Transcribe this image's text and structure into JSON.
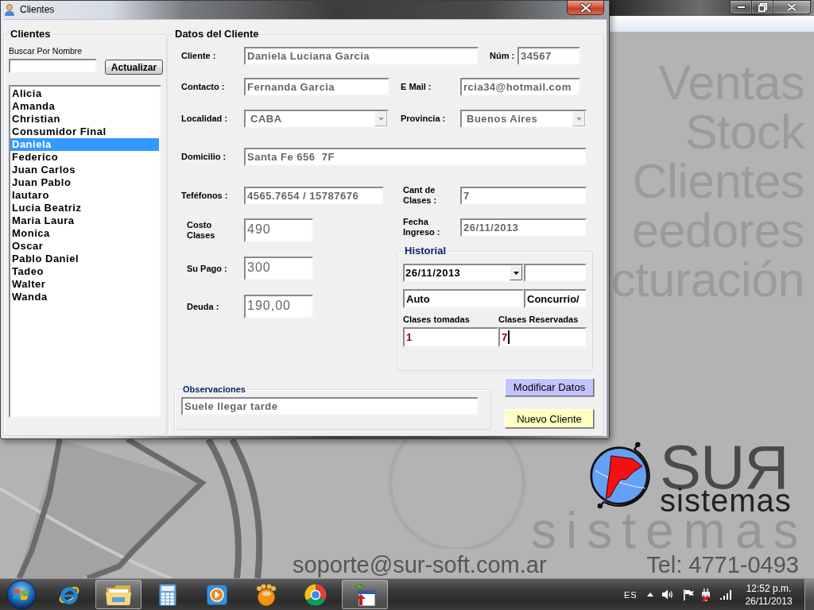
{
  "main_window": {
    "modules": [
      "Ventas",
      "Stock",
      "Clientes",
      "eedores",
      "cturación"
    ],
    "background_word": "sistemas",
    "logo": {
      "wordmark": "SUЯ",
      "tagline": "sistemas"
    },
    "email": "soporte@sur-soft.com.ar",
    "phone": "Tel: 4771-0493"
  },
  "dialog": {
    "title": "Clientes",
    "clients_group": {
      "title": "Clientes",
      "search_label": "Buscar Por Nombre",
      "refresh_button": "Actualizar",
      "items": [
        {
          "label": "Alicia",
          "selected": false
        },
        {
          "label": "Amanda",
          "selected": false
        },
        {
          "label": "Christian",
          "selected": false
        },
        {
          "label": "Consumidor Final",
          "selected": false
        },
        {
          "label": "Daniela",
          "selected": true
        },
        {
          "label": "Federico",
          "selected": false
        },
        {
          "label": "Juan Carlos",
          "selected": false
        },
        {
          "label": "Juan Pablo",
          "selected": false
        },
        {
          "label": "Iautaro",
          "selected": false
        },
        {
          "label": "Lucia Beatriz",
          "selected": false
        },
        {
          "label": "Maria Laura",
          "selected": false
        },
        {
          "label": "Monica",
          "selected": false
        },
        {
          "label": "Oscar",
          "selected": false
        },
        {
          "label": "Pablo Daniel",
          "selected": false
        },
        {
          "label": "Tadeo",
          "selected": false
        },
        {
          "label": "Walter",
          "selected": false
        },
        {
          "label": "Wanda",
          "selected": false
        }
      ]
    },
    "details_group": {
      "title": "Datos del Cliente",
      "cliente": {
        "label": "Cliente :",
        "value": "Daniela Luciana Garcia",
        "disabled": true
      },
      "num": {
        "label": "Núm :",
        "value": "34567",
        "disabled": true
      },
      "contacto": {
        "label": "Contacto :",
        "value": "Fernanda Garcia",
        "disabled": true
      },
      "email": {
        "label": "E Mail :",
        "value": "rcia34@hotmail.com",
        "disabled": true
      },
      "localidad": {
        "label": "Localidad :",
        "value": "CABA",
        "disabled": true
      },
      "provincia": {
        "label": "Provincia :",
        "value": "Buenos Aires",
        "disabled": true
      },
      "domicilio": {
        "label": "Domicilio :",
        "value": "Santa Fe 656  7F",
        "disabled": true
      },
      "telefonos": {
        "label": "Teféfonos :",
        "value": "4565.7654 / 15787676",
        "disabled": true
      },
      "cant_clases": {
        "label": "Cant de Clases :",
        "value": "7",
        "disabled": true
      },
      "costo_clases": {
        "label": "Costo Clases",
        "value": "490",
        "disabled": true
      },
      "su_pago": {
        "label": "Su Pago :",
        "value": "300",
        "disabled": true
      },
      "deuda": {
        "label": "Deuda :",
        "value": "190,00",
        "disabled": true
      },
      "fecha_ingreso": {
        "label": "Fecha Ingreso :",
        "value": "26/11/2013",
        "disabled": true
      },
      "historial": {
        "title": "Historial",
        "fields": [
          {
            "kind": "combo",
            "value": "26/11/2013",
            "disabled": false
          },
          {
            "kind": "text"
          },
          {
            "kind": "text",
            "value": "Auto",
            "disabled": false
          },
          {
            "kind": "text",
            "value": "Concurrio/",
            "disabled": false
          }
        ],
        "counters": [
          {
            "label": "Clases tomadas",
            "value": "1",
            "focused": false
          },
          {
            "label": "Clases Reservadas",
            "value": "7",
            "focused": true
          }
        ]
      },
      "observaciones": {
        "title": "Observaciones",
        "value": "Suele llegar tarde",
        "disabled": true
      },
      "buttons": [
        {
          "kind": "modify",
          "label": "Modificar Datos"
        },
        {
          "kind": "new",
          "label": "Nuevo Cliente"
        }
      ]
    }
  },
  "taskbar": {
    "apps": [
      {
        "kind": "browser_e",
        "running": false
      },
      {
        "kind": "folder",
        "running": true
      },
      {
        "kind": "calculator",
        "running": false
      },
      {
        "kind": "player",
        "running": false
      },
      {
        "kind": "ball",
        "running": false
      },
      {
        "kind": "browser_wheel",
        "running": false
      },
      {
        "kind": "app_window",
        "running": true
      }
    ],
    "tray": {
      "language": "ES",
      "time": "12:52 p.m.",
      "date": "26/11/2013"
    }
  }
}
